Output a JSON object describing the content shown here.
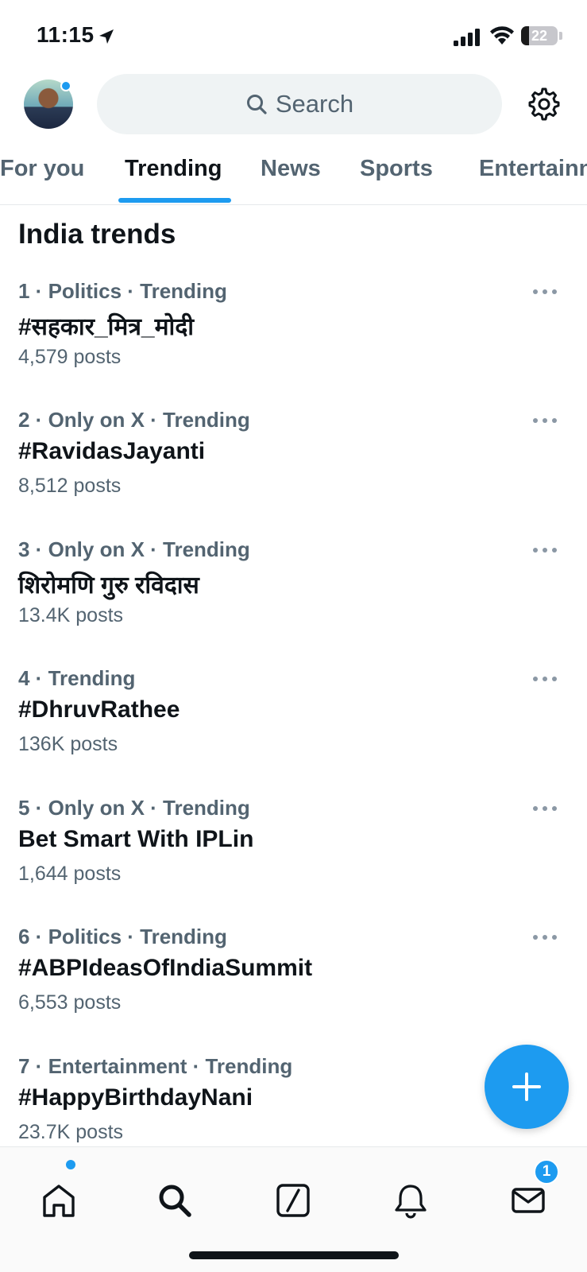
{
  "status_bar": {
    "time": "11:15",
    "battery_level": "22",
    "battery_fraction": 0.22
  },
  "header": {
    "search_placeholder": "Search",
    "icons": [
      "avatar",
      "search-icon",
      "settings-icon"
    ]
  },
  "tabs": [
    {
      "label": "For you",
      "active": false
    },
    {
      "label": "Trending",
      "active": true
    },
    {
      "label": "News",
      "active": false
    },
    {
      "label": "Sports",
      "active": false
    },
    {
      "label": "Entertainn",
      "active": false
    }
  ],
  "section_title": "India trends",
  "trends": [
    {
      "meta": "1 · Politics · Trending",
      "name": "#सहकार_मित्र_मोदी",
      "count": "4,579 posts"
    },
    {
      "meta": "2 · Only on X · Trending",
      "name": "#RavidasJayanti",
      "count": "8,512 posts"
    },
    {
      "meta": "3 · Only on X · Trending",
      "name": "शिरोमणि गुरु रविदास",
      "count": "13.4K posts"
    },
    {
      "meta": "4 · Trending",
      "name": "#DhruvRathee",
      "count": "136K posts"
    },
    {
      "meta": "5 · Only on X · Trending",
      "name": "Bet Smart With IPLin",
      "count": "1,644 posts"
    },
    {
      "meta": "6 · Politics · Trending",
      "name": "#ABPIdeasOfIndiaSummit",
      "count": "6,553 posts"
    },
    {
      "meta": "7 · Entertainment · Trending",
      "name": "#HappyBirthdayNani",
      "count": "23.7K posts"
    }
  ],
  "bottom_nav": {
    "items": [
      "home-icon",
      "search-icon",
      "grok-icon",
      "notifications-icon",
      "messages-icon"
    ],
    "messages_badge": "1"
  },
  "colors": {
    "accent": "#1d9bf0",
    "text_primary": "#0f1419",
    "text_secondary": "#536471",
    "search_bg": "#eff3f4"
  }
}
